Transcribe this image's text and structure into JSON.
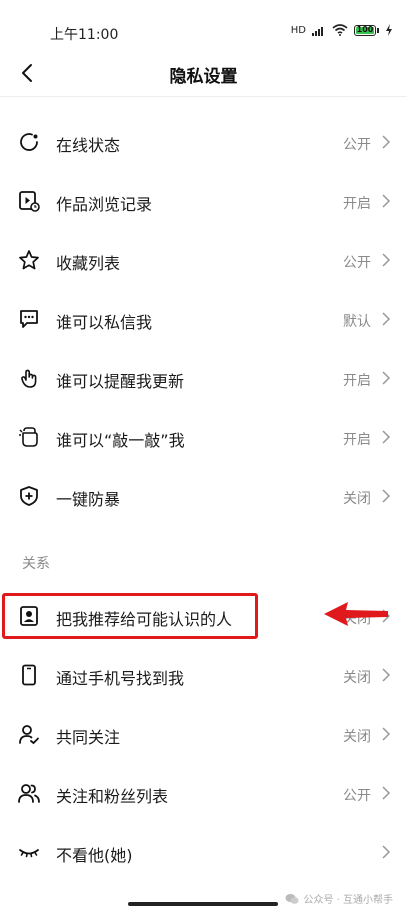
{
  "status": {
    "time": "上午11:00",
    "network": "HD",
    "battery": "100"
  },
  "header": {
    "title": "隐私设置"
  },
  "items": [
    {
      "label": "在线状态",
      "value": "公开"
    },
    {
      "label": "作品浏览记录",
      "value": "开启"
    },
    {
      "label": "收藏列表",
      "value": "公开"
    },
    {
      "label": "谁可以私信我",
      "value": "默认"
    },
    {
      "label": "谁可以提醒我更新",
      "value": "开启"
    },
    {
      "label": "谁可以“敲一敲”我",
      "value": "开启"
    },
    {
      "label": "一键防暴",
      "value": "关闭"
    }
  ],
  "section_relation": "关系",
  "relation_items": [
    {
      "label": "把我推荐给可能认识的人",
      "value": "关闭"
    },
    {
      "label": "通过手机号找到我",
      "value": "关闭"
    },
    {
      "label": "共同关注",
      "value": "关闭"
    },
    {
      "label": "关注和粉丝列表",
      "value": "公开"
    },
    {
      "label": "不看他(她)",
      "value": ""
    }
  ],
  "footer": {
    "text": "公众号 · 互通小帮手"
  },
  "colors": {
    "highlight": "#e0191c",
    "battery": "#35c24d"
  }
}
